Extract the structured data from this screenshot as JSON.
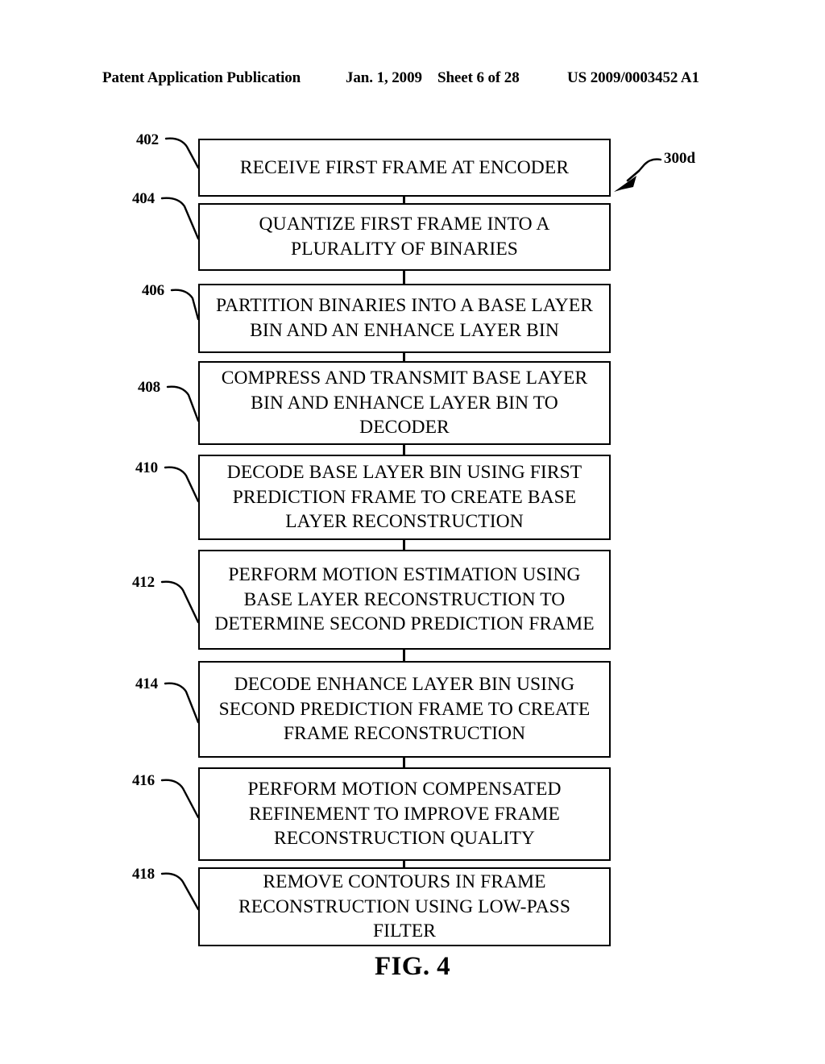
{
  "header": {
    "publication": "Patent Application Publication",
    "date": "Jan. 1, 2009",
    "sheet": "Sheet 6 of 28",
    "patent_number": "US 2009/0003452 A1"
  },
  "figure": {
    "caption": "FIG. 4",
    "diagram_label": "300d"
  },
  "flowchart": {
    "steps": [
      {
        "ref": "402",
        "text": "RECEIVE FIRST FRAME AT ENCODER"
      },
      {
        "ref": "404",
        "text": "QUANTIZE FIRST FRAME INTO A PLURALITY OF BINARIES"
      },
      {
        "ref": "406",
        "text": "PARTITION BINARIES INTO A BASE LAYER BIN AND AN ENHANCE LAYER BIN"
      },
      {
        "ref": "408",
        "text": "COMPRESS AND TRANSMIT BASE LAYER BIN AND ENHANCE LAYER BIN TO DECODER"
      },
      {
        "ref": "410",
        "text": "DECODE BASE LAYER BIN USING FIRST PREDICTION FRAME TO CREATE BASE LAYER RECONSTRUCTION"
      },
      {
        "ref": "412",
        "text": "PERFORM MOTION ESTIMATION USING BASE LAYER RECONSTRUCTION TO DETERMINE SECOND PREDICTION FRAME"
      },
      {
        "ref": "414",
        "text": "DECODE ENHANCE LAYER BIN USING SECOND PREDICTION FRAME TO CREATE FRAME RECONSTRUCTION"
      },
      {
        "ref": "416",
        "text": "PERFORM MOTION COMPENSATED REFINEMENT TO IMPROVE FRAME RECONSTRUCTION QUALITY"
      },
      {
        "ref": "418",
        "text": "REMOVE CONTOURS IN FRAME RECONSTRUCTION USING LOW-PASS FILTER"
      }
    ]
  },
  "colors": {
    "ink": "#000000",
    "page": "#ffffff"
  }
}
